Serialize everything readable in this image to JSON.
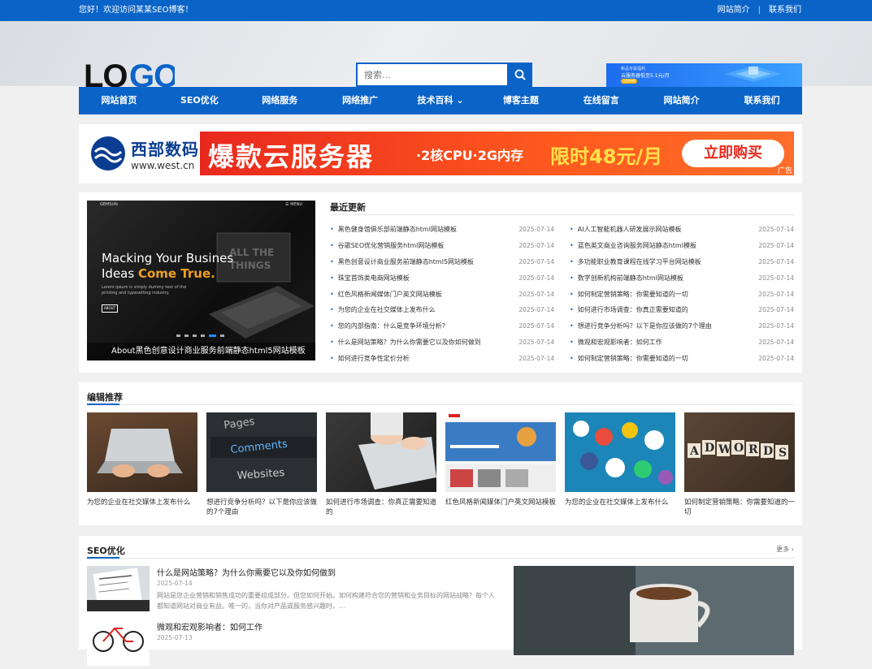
{
  "topbar": {
    "welcome": "您好！欢迎访问某某SEO博客！",
    "links": [
      {
        "label": "网站简介"
      },
      {
        "label": "联系我们"
      }
    ]
  },
  "header": {
    "logo_text": "LOGO",
    "search_placeholder": "搜索...",
    "banner": {
      "line1": "新品专属福利",
      "line2": "云服务器低至5.1元/月",
      "btn": "立即抢购"
    }
  },
  "nav": [
    {
      "label": "网站首页"
    },
    {
      "label": "SEO优化"
    },
    {
      "label": "网络服务"
    },
    {
      "label": "网络推广"
    },
    {
      "label": "技术百科 ⌄"
    },
    {
      "label": "博客主题"
    },
    {
      "label": "在线留言"
    },
    {
      "label": "网站简介"
    },
    {
      "label": "联系我们"
    }
  ],
  "ad": {
    "brand_cn": "西部数码",
    "brand_url": "www.west.cn",
    "headline": "爆款云服务器",
    "spec": "·2核CPU·2G内存",
    "price": "限时48元/月",
    "cta": "立即购买",
    "tag": "广告"
  },
  "slider": {
    "brand": "GEMSUN",
    "menu": "☰ MENU",
    "headline_a": "Macking Your Busines",
    "headline_b": "Ideas ",
    "headline_c": "Come True.",
    "desc": "Lorem ipsum is simply dummy text of the printing and typesetting industry.",
    "more": "ABOUT",
    "caption": "About黑色创意设计商业服务前端静态html5网站模板"
  },
  "latest": {
    "title": "最近更新",
    "left": [
      {
        "title": "黑色健身馆俱乐部前端静态html网站模板",
        "date": "2025-07-14"
      },
      {
        "title": "谷歌SEO优化营销服务html网站模板",
        "date": "2025-07-14"
      },
      {
        "title": "黑色创意设计商业服务前端静态html5网站模板",
        "date": "2025-07-14"
      },
      {
        "title": "珠宝首饰类电商网站模板",
        "date": "2025-07-14"
      },
      {
        "title": "红色风格新闻媒体门户英文网站模板",
        "date": "2025-07-14"
      },
      {
        "title": "为您的企业在社交媒体上发布什么",
        "date": "2025-07-14"
      },
      {
        "title": "您的内部指南：什么是竞争环境分析?",
        "date": "2025-07-14"
      },
      {
        "title": "什么是网站策略？为什么你需要它以及你如何做到",
        "date": "2025-07-14"
      },
      {
        "title": "如何进行竞争性定价分析",
        "date": "2025-07-14"
      }
    ],
    "right": [
      {
        "title": "AI人工智能机器人研发展示网站模板",
        "date": "2025-07-14"
      },
      {
        "title": "蓝色英文商业咨询服务网站静态html模板",
        "date": "2025-07-14"
      },
      {
        "title": "多功能职业教育课程在线学习平台网站模板",
        "date": "2025-07-14"
      },
      {
        "title": "数字创新机构前端静态html网站模板",
        "date": "2025-07-14"
      },
      {
        "title": "如何制定营销策略：你需要知道的一切",
        "date": "2025-07-14"
      },
      {
        "title": "如何进行市场调查：你真正需要知道的",
        "date": "2025-07-14"
      },
      {
        "title": "想进行竞争分析吗？以下是你应该做的7个理由",
        "date": "2025-07-14"
      },
      {
        "title": "微观和宏观影响者：如何工作",
        "date": "2025-07-14"
      },
      {
        "title": "如何制定营销策略：你需要知道的一切",
        "date": "2025-07-14"
      }
    ]
  },
  "editor": {
    "title": "编辑推荐",
    "items": [
      {
        "caption": "为您的企业在社交媒体上发布什么"
      },
      {
        "caption": "想进行竞争分析吗？以下是你应该做的7个理由"
      },
      {
        "caption": "如何进行市场调查：你真正需要知道的"
      },
      {
        "caption": "红色风格新闻媒体门户英文网站模板"
      },
      {
        "caption": "为您的企业在社交媒体上发布什么"
      },
      {
        "caption": "如何制定营销策略：你需要知道的一切"
      }
    ],
    "img_pages": "Pages",
    "img_comments": "Comments",
    "img_websites": "Websites",
    "img_adwords": [
      "A",
      "D",
      "W",
      "O",
      "R",
      "D",
      "S"
    ]
  },
  "seo": {
    "title": "SEO优化",
    "more": "更多 ›",
    "articles": [
      {
        "title": "什么是网站策略？为什么你需要它以及你如何做到",
        "date": "2025-07-14",
        "summary": "网站是您企业营销和销售成功的重要组成部分。但您如何开始。如何构建符合您的营销和业务目标的网站战略？每个人都知道网站对商业有益。唯一的，当你对产品或服务感兴趣时，..."
      },
      {
        "title": "微观和宏观影响者：如何工作",
        "date": "2025-07-13",
        "summary": ""
      }
    ]
  }
}
